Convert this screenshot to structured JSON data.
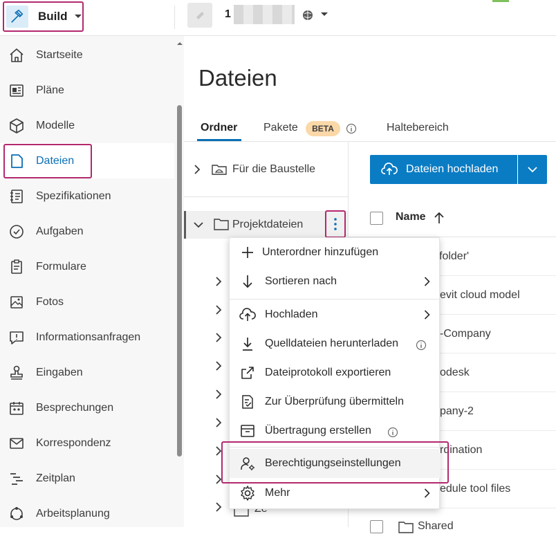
{
  "topbar": {
    "product_label": "Build",
    "project_name": "1"
  },
  "sidebar": {
    "items": [
      {
        "label": "Startseite",
        "icon": "home-icon"
      },
      {
        "label": "Pläne",
        "icon": "sheets-icon"
      },
      {
        "label": "Modelle",
        "icon": "cube-icon"
      },
      {
        "label": "Dateien",
        "icon": "file-icon",
        "active": true
      },
      {
        "label": "Spezifikationen",
        "icon": "specifications-icon"
      },
      {
        "label": "Aufgaben",
        "icon": "check-circle-icon"
      },
      {
        "label": "Formulare",
        "icon": "clipboard-icon"
      },
      {
        "label": "Fotos",
        "icon": "photo-icon"
      },
      {
        "label": "Informationsanfragen",
        "icon": "rfi-icon"
      },
      {
        "label": "Eingaben",
        "icon": "stamp-icon"
      },
      {
        "label": "Besprechungen",
        "icon": "meetings-icon"
      },
      {
        "label": "Korrespondenz",
        "icon": "mail-icon"
      },
      {
        "label": "Zeitplan",
        "icon": "schedule-icon"
      },
      {
        "label": "Arbeitsplanung",
        "icon": "workplanning-icon"
      }
    ]
  },
  "main": {
    "title": "Dateien",
    "tabs": {
      "ordner": "Ordner",
      "pakete": "Pakete",
      "beta": "BETA",
      "haltebereich": "Haltebereich"
    },
    "tree": {
      "baustelle": "Für die Baustelle",
      "projektdateien": "Projektdateien",
      "partial_folder": "Ze"
    },
    "upload_button": "Dateien hochladen",
    "column_name": "Name",
    "files": [
      "folder'",
      "evit cloud model",
      "-Company",
      "odesk",
      "pany-2",
      "rdination",
      "edule tool files",
      "Shared"
    ]
  },
  "context_menu": {
    "items": [
      {
        "label": "Unterordner hinzufügen",
        "icon": "plus-icon"
      },
      {
        "label": "Sortieren nach",
        "icon": "sort-down-icon",
        "submenu": true
      },
      {
        "label": "Hochladen",
        "icon": "cloud-upload-icon",
        "submenu": true
      },
      {
        "label": "Quelldateien herunterladen",
        "icon": "download-icon",
        "info": true
      },
      {
        "label": "Dateiprotokoll exportieren",
        "icon": "export-icon"
      },
      {
        "label": "Zur Überprüfung übermitteln",
        "icon": "review-icon"
      },
      {
        "label": "Übertragung erstellen",
        "icon": "transmittal-icon",
        "info": true
      },
      {
        "label": "Berechtigungseinstellungen",
        "icon": "user-settings-icon"
      },
      {
        "label": "Mehr",
        "icon": "gear-icon",
        "submenu": true
      }
    ]
  },
  "colors": {
    "accent": "#0a7cc4",
    "highlight": "#b3286e",
    "active_nav": "#0a6fb5",
    "beta_badge": "#fbd8a8"
  }
}
